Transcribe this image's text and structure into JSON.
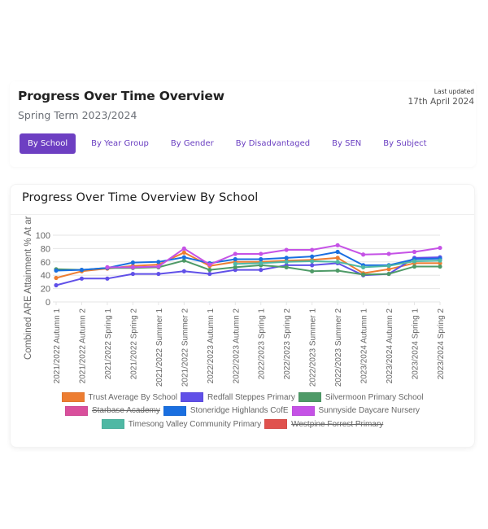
{
  "header": {
    "title": "Progress Over Time Overview",
    "subtitle": "Spring Term 2023/2024",
    "last_updated_label": "Last updated",
    "last_updated_date": "17th April 2024"
  },
  "tabs": [
    {
      "label": "By School",
      "active": true
    },
    {
      "label": "By Year Group",
      "active": false
    },
    {
      "label": "By Gender",
      "active": false
    },
    {
      "label": "By Disadvantaged",
      "active": false
    },
    {
      "label": "By SEN",
      "active": false
    },
    {
      "label": "By Subject",
      "active": false
    }
  ],
  "colors": {
    "accent": "#6d3fc2"
  },
  "chart_data": {
    "type": "line",
    "title": "Progress Over Time Overview By School",
    "xlabel": "",
    "ylabel": "Combined ARE Attainment % At ar",
    "ylim": [
      0,
      100
    ],
    "yticks": [
      0,
      20,
      40,
      60,
      80,
      100
    ],
    "grid": true,
    "legend_position": "bottom",
    "categories": [
      "2021/2022 Autumn 1",
      "2021/2022 Autumn 2",
      "2021/2022 Spring 1",
      "2021/2022 Spring 2",
      "2021/2022 Summer 1",
      "2021/2022 Summer 2",
      "2022/2023 Autumn 1",
      "2022/2023 Autumn 2",
      "2022/2023 Spring 1",
      "2022/2023 Spring 2",
      "2022/2023 Summer 1",
      "2022/2023 Summer 2",
      "2023/2024 Autumn 1",
      "2023/2024 Autumn 2",
      "2023/2024 Spring 1",
      "2023/2024 Spring 2"
    ],
    "series": [
      {
        "name": "Trust Average By School",
        "color": "#ed7d31",
        "hidden": false,
        "values": [
          36,
          46,
          50,
          54,
          56,
          74,
          54,
          60,
          60,
          62,
          63,
          66,
          43,
          49,
          58,
          58
        ]
      },
      {
        "name": "Redfall Steppes Primary",
        "color": "#6050e8",
        "hidden": false,
        "values": [
          25,
          35,
          35,
          42,
          42,
          46,
          42,
          48,
          48,
          55,
          55,
          58,
          40,
          42,
          66,
          67
        ]
      },
      {
        "name": "Silvermoon Primary School",
        "color": "#4e9a67",
        "hidden": false,
        "values": [
          49,
          48,
          51,
          51,
          52,
          62,
          48,
          52,
          55,
          52,
          46,
          47,
          41,
          42,
          53,
          53
        ]
      },
      {
        "name": "Starbase Academy",
        "color": "#d94f9c",
        "hidden": true,
        "values": []
      },
      {
        "name": "Stoneridge Highlands CofE",
        "color": "#1a6fe0",
        "hidden": false,
        "values": [
          47,
          48,
          51,
          59,
          60,
          67,
          58,
          64,
          64,
          66,
          68,
          75,
          55,
          55,
          64,
          65
        ]
      },
      {
        "name": "Sunnyside Daycare Nursery",
        "color": "#c552e6",
        "hidden": false,
        "values": [
          null,
          null,
          52,
          52,
          53,
          80,
          56,
          72,
          72,
          78,
          78,
          85,
          71,
          72,
          75,
          81
        ]
      },
      {
        "name": "Timesong Valley Community Primary",
        "color": "#4fb8a4",
        "hidden": false,
        "values": [
          null,
          null,
          null,
          null,
          null,
          null,
          null,
          57,
          58,
          60,
          61,
          60,
          52,
          54,
          61,
          62
        ]
      },
      {
        "name": "Westpine Forrest Primary",
        "color": "#e0514d",
        "hidden": true,
        "values": []
      }
    ]
  }
}
